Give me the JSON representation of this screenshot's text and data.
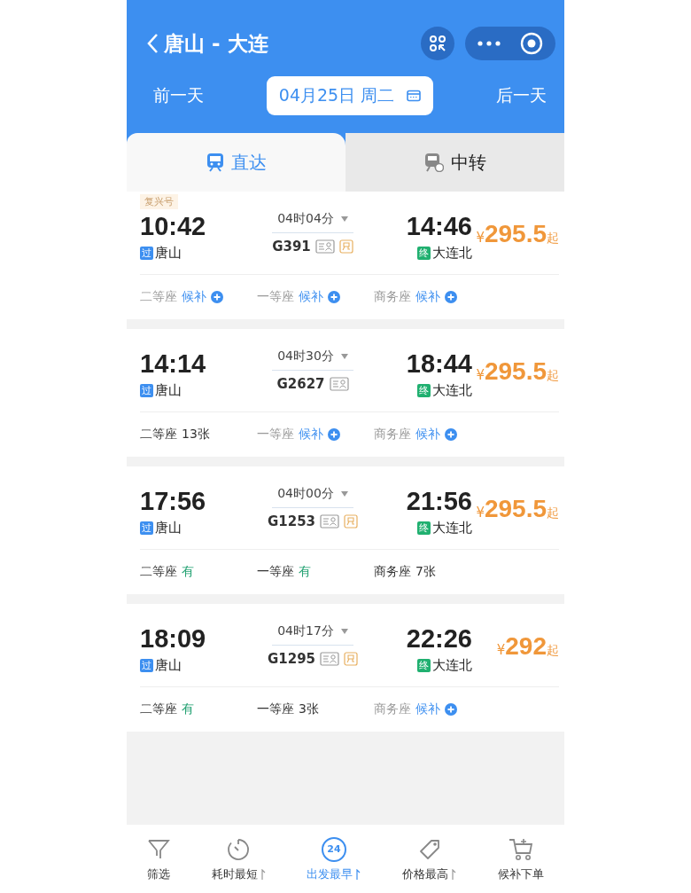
{
  "header": {
    "title": "唐山 - 大连",
    "prev_day": "前一天",
    "date": "04月25日 周二",
    "next_day": "后一天"
  },
  "tabs": [
    {
      "label": "直达",
      "kind": "direct",
      "selected": true
    },
    {
      "label": "中转",
      "kind": "transfer",
      "selected": false
    }
  ],
  "trains": [
    {
      "badge": "复兴号",
      "dep_time": "10:42",
      "dep_mark": "过",
      "dep_station": "唐山",
      "duration": "04时04分",
      "number": "G391",
      "tags": [
        {
          "kind": "id"
        },
        {
          "kind": "exchange"
        }
      ],
      "arr_time": "14:46",
      "arr_mark": "终",
      "arr_station": "大连北",
      "currency": "¥",
      "price": "295.5",
      "price_suffix": "起",
      "seats": [
        {
          "label": "二等座",
          "kind": "waitlist",
          "status": "候补"
        },
        {
          "label": "一等座",
          "kind": "waitlist",
          "status": "候补"
        },
        {
          "label": "商务座",
          "kind": "waitlist",
          "status": "候补"
        }
      ]
    },
    {
      "dep_time": "14:14",
      "dep_mark": "过",
      "dep_station": "唐山",
      "duration": "04时30分",
      "number": "G2627",
      "tags": [
        {
          "kind": "id"
        }
      ],
      "arr_time": "18:44",
      "arr_mark": "终",
      "arr_station": "大连北",
      "currency": "¥",
      "price": "295.5",
      "price_suffix": "起",
      "seats": [
        {
          "label": "二等座",
          "kind": "count",
          "status": "13张"
        },
        {
          "label": "一等座",
          "kind": "waitlist",
          "status": "候补"
        },
        {
          "label": "商务座",
          "kind": "waitlist",
          "status": "候补"
        }
      ]
    },
    {
      "dep_time": "17:56",
      "dep_mark": "过",
      "dep_station": "唐山",
      "duration": "04时00分",
      "number": "G1253",
      "tags": [
        {
          "kind": "id"
        },
        {
          "kind": "exchange"
        }
      ],
      "arr_time": "21:56",
      "arr_mark": "终",
      "arr_station": "大连北",
      "currency": "¥",
      "price": "295.5",
      "price_suffix": "起",
      "seats": [
        {
          "label": "二等座",
          "kind": "available",
          "status": "有"
        },
        {
          "label": "一等座",
          "kind": "available",
          "status": "有"
        },
        {
          "label": "商务座",
          "kind": "count",
          "status": "7张"
        }
      ]
    },
    {
      "dep_time": "18:09",
      "dep_mark": "过",
      "dep_station": "唐山",
      "duration": "04时17分",
      "number": "G1295",
      "tags": [
        {
          "kind": "id"
        },
        {
          "kind": "exchange"
        }
      ],
      "arr_time": "22:26",
      "arr_mark": "终",
      "arr_station": "大连北",
      "currency": "¥",
      "price": "292",
      "price_suffix": "起",
      "seats": [
        {
          "label": "二等座",
          "kind": "available",
          "status": "有"
        },
        {
          "label": "一等座",
          "kind": "count",
          "status": "3张"
        },
        {
          "label": "商务座",
          "kind": "waitlist",
          "status": "候补"
        }
      ]
    }
  ],
  "bottom_bar": [
    {
      "label": "筛选",
      "kind": "filter",
      "sortable": false,
      "selected": false
    },
    {
      "label": "耗时最短",
      "kind": "timer",
      "sortable": true,
      "selected": false
    },
    {
      "label": "出发最早",
      "kind": "clock",
      "icon_text": "24",
      "sortable": true,
      "selected": true
    },
    {
      "label": "价格最高",
      "kind": "tag",
      "sortable": true,
      "selected": false
    },
    {
      "label": "候补下单",
      "kind": "cart",
      "sortable": false,
      "selected": false
    }
  ]
}
